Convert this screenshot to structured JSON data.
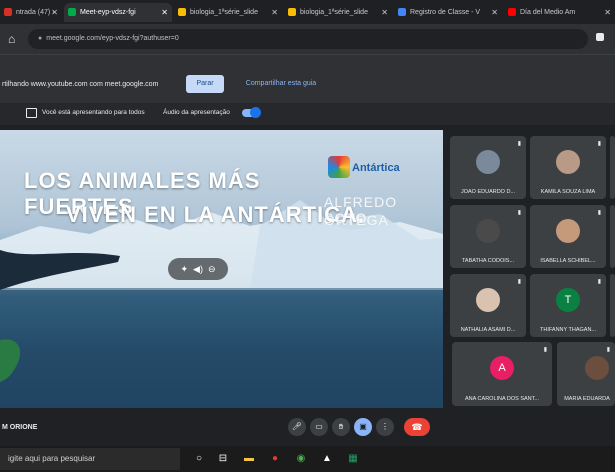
{
  "browser": {
    "tabs": [
      {
        "label": "ntrada (47) ·",
        "active": false,
        "color": "#d93025"
      },
      {
        "label": "Meet-eyp-vdsz-fgi",
        "active": true,
        "color": "#00ac47"
      },
      {
        "label": "biologia_1ªsérie_slide",
        "active": false,
        "color": "#fbbc04"
      },
      {
        "label": "biologia_1ªsérie_slide",
        "active": false,
        "color": "#fbbc04"
      },
      {
        "label": "Registro de Classe - V",
        "active": false,
        "color": "#4285f4"
      },
      {
        "label": "Día del Medio Am",
        "active": false,
        "color": "#ff0000"
      }
    ],
    "url": "meet.google.com/eyp-vdsz-fgi?authuser=0"
  },
  "share_bar": {
    "text": "rtilhando www.youtube.com com meet.google.com",
    "stop_label": "Parar",
    "share_tab_label": "Compartilhar esta guia"
  },
  "presenting_bar": {
    "status": "Você está apresentando para todos",
    "audio_label": "Áudio da apresentação"
  },
  "slide": {
    "title_line1": "LOS ANIMALES MÁS FUERTES",
    "title_line2": "VIVEN EN LA ANTÁRTICA.",
    "brand": "Antártica",
    "author_line1": "ALFREDO SOTO",
    "author_line2": "ORTEGA"
  },
  "participants": [
    {
      "name": "JOAO EDUARDO D...",
      "initial": "",
      "bg": "#3c4043"
    },
    {
      "name": "KAMILA SOUZA LIMA",
      "initial": "",
      "bg": "#3c4043"
    },
    {
      "name": "TABATHA CODOIS...",
      "initial": "",
      "bg": "#3c4043"
    },
    {
      "name": "ISABELLA SCHIBEL...",
      "initial": "",
      "bg": "#3c4043"
    },
    {
      "name": "NATHALIA ASAMI D...",
      "initial": "",
      "bg": "#3c4043"
    },
    {
      "name": "THIFANNY THAGAN...",
      "initial": "T",
      "bg": "#0b8043"
    },
    {
      "name": "ANA CAROLINA DOS SANT...",
      "initial": "A",
      "bg": "#e91e63"
    },
    {
      "name": "MARIA EDUARDA",
      "initial": "",
      "bg": "#3c4043"
    }
  ],
  "callbar": {
    "user_name": "M ORIONE"
  },
  "taskbar": {
    "search_placeholder": "igite aqui para pesquisar"
  }
}
